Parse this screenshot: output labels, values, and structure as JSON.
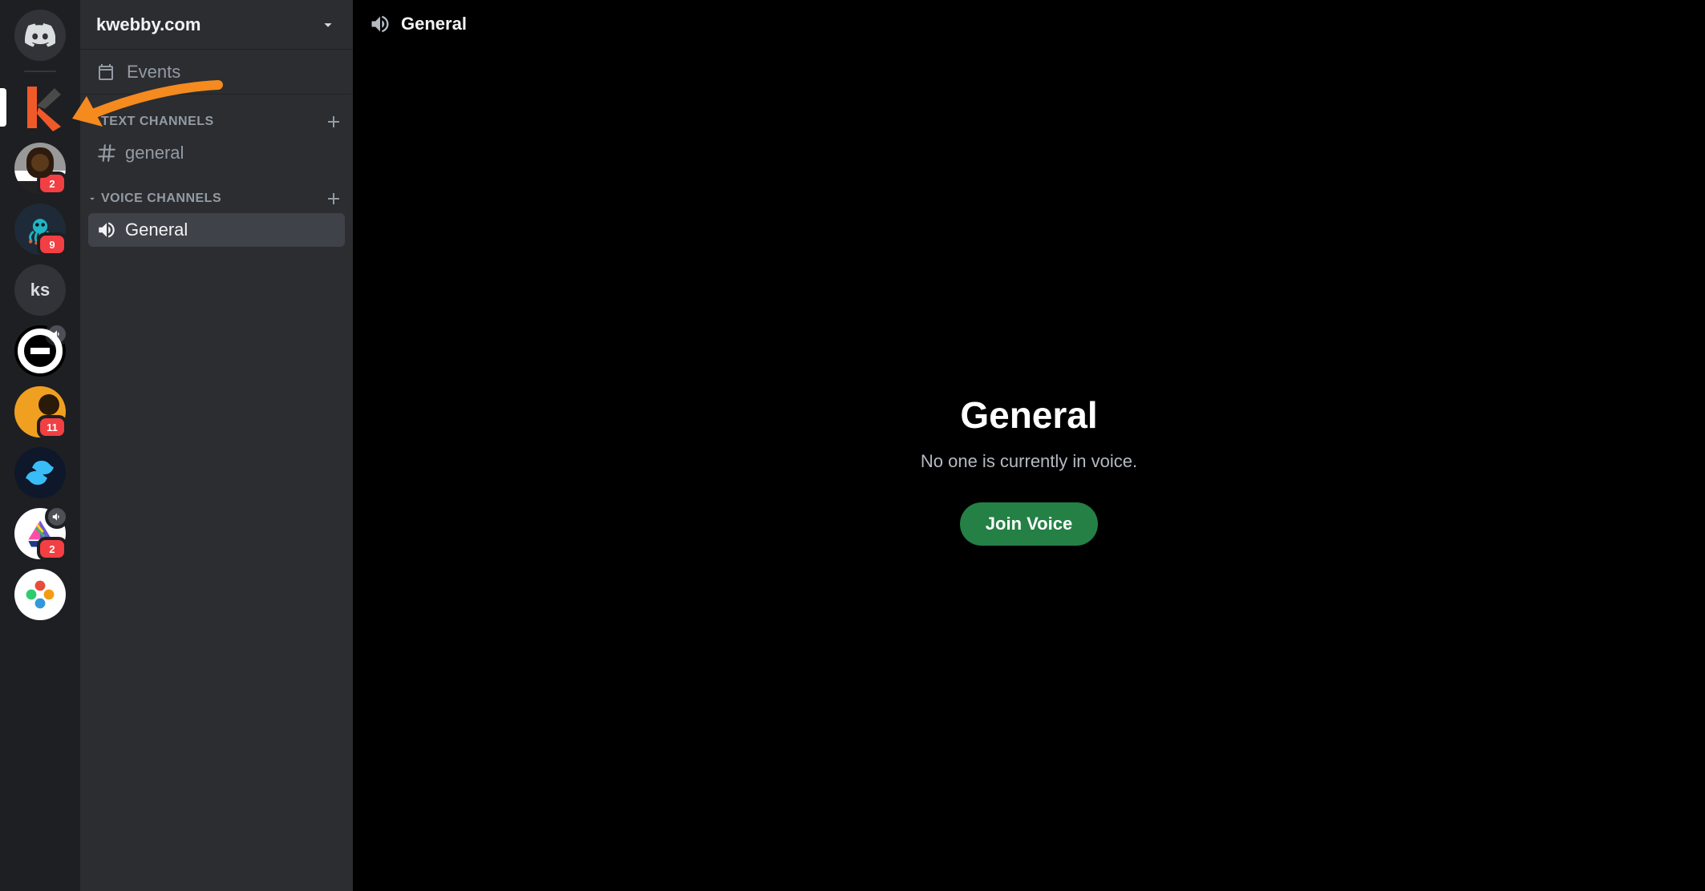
{
  "server_rail": {
    "servers": [
      {
        "id": "dm",
        "type": "discord"
      },
      {
        "id": "kwebby",
        "type": "kwebby",
        "selected": true
      },
      {
        "id": "avatar1",
        "type": "avatar1",
        "badge": "2"
      },
      {
        "id": "octo",
        "type": "octo",
        "badge": "9"
      },
      {
        "id": "ks",
        "type": "text",
        "label": "ks"
      },
      {
        "id": "theta",
        "type": "theta",
        "voice_indicator": true,
        "voice_indicator_color": "gray"
      },
      {
        "id": "yellow",
        "type": "yellow",
        "badge": "11"
      },
      {
        "id": "tailwind",
        "type": "tailwind"
      },
      {
        "id": "boat",
        "type": "boat",
        "badge": "2",
        "voice_indicator": true,
        "voice_indicator_color": "gray"
      },
      {
        "id": "multicolor",
        "type": "multicolor"
      }
    ]
  },
  "channel_sidebar": {
    "server_name": "kwebby.com",
    "events_label": "Events",
    "categories": [
      {
        "name": "TEXT CHANNELS",
        "channels": [
          {
            "name": "general",
            "type": "text",
            "selected": false
          }
        ]
      },
      {
        "name": "VOICE CHANNELS",
        "channels": [
          {
            "name": "General",
            "type": "voice",
            "selected": true
          }
        ]
      }
    ]
  },
  "main": {
    "header_channel": "General",
    "title": "General",
    "subtitle": "No one is currently in voice.",
    "join_button": "Join Voice"
  },
  "annotation": {
    "arrow_color": "#f58a1f"
  }
}
